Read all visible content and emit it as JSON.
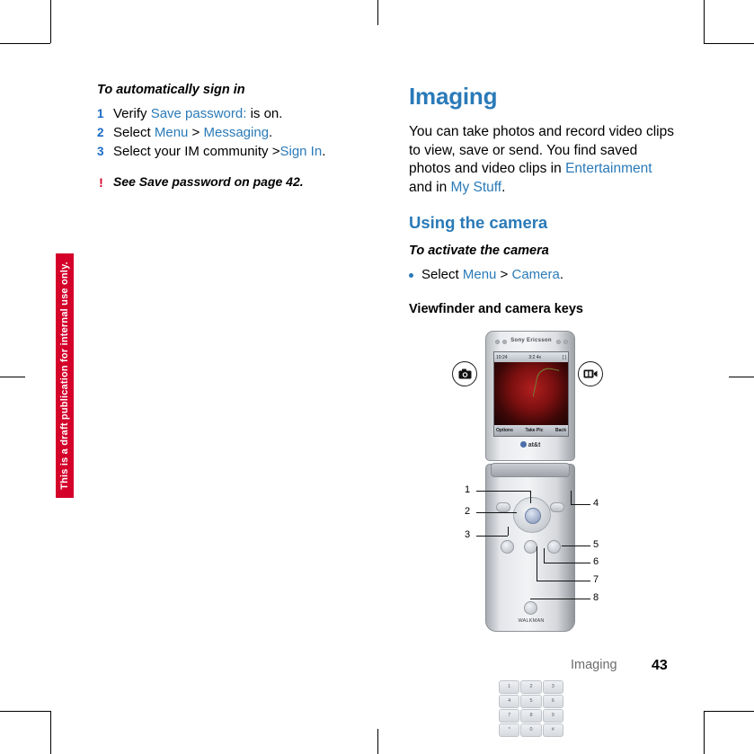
{
  "page": {
    "draft_banner": "This is a draft publication for internal use only.",
    "footer_label": "Imaging",
    "page_number": "43"
  },
  "left_column": {
    "heading": "To automatically sign in",
    "steps": [
      {
        "num": "1",
        "parts": [
          {
            "text": "Verify ",
            "style": "plain"
          },
          {
            "text": "Save password:",
            "style": "link"
          },
          {
            "text": " is on.",
            "style": "plain"
          }
        ]
      },
      {
        "num": "2",
        "parts": [
          {
            "text": "Select ",
            "style": "plain"
          },
          {
            "text": "Menu",
            "style": "link"
          },
          {
            "text": " > ",
            "style": "plain"
          },
          {
            "text": "Messaging",
            "style": "link"
          },
          {
            "text": ".",
            "style": "plain"
          }
        ]
      },
      {
        "num": "3",
        "parts": [
          {
            "text": "Select your IM community >",
            "style": "plain"
          },
          {
            "text": "Sign In",
            "style": "link"
          },
          {
            "text": ".",
            "style": "plain"
          }
        ]
      }
    ],
    "note": {
      "icon": "exclamation-icon",
      "text": "See Save password on page 42."
    }
  },
  "right_column": {
    "title": "Imaging",
    "intro": [
      {
        "text": "You can take photos and record video clips to view, save or send. You find saved photos and video clips in ",
        "style": "plain"
      },
      {
        "text": "Entertainment",
        "style": "link"
      },
      {
        "text": " and in ",
        "style": "plain"
      },
      {
        "text": "My Stuff",
        "style": "link"
      },
      {
        "text": ".",
        "style": "plain"
      }
    ],
    "section_heading": "Using the camera",
    "sub_heading": "To activate the camera",
    "bullet": [
      {
        "text": "Select ",
        "style": "plain"
      },
      {
        "text": "Menu",
        "style": "link"
      },
      {
        "text": " > ",
        "style": "plain"
      },
      {
        "text": "Camera",
        "style": "link"
      },
      {
        "text": ".",
        "style": "plain"
      }
    ],
    "figure_caption": "Viewfinder and camera keys"
  },
  "phone_figure": {
    "callout_left_icon": "camera-icon",
    "callout_right_icon": "video-camera-icon",
    "brand": "Sony Ericsson",
    "carrier": "at&t",
    "screen": {
      "status_left": "10:24",
      "status_mid": "3:2  4x",
      "status_right": "[  ]",
      "soft_left": "Options",
      "soft_mid": "Take Pic",
      "soft_right": "Back"
    },
    "keypad_keys": [
      "1",
      "2",
      "3",
      "4",
      "5",
      "6",
      "7",
      "8",
      "9",
      "*",
      "0",
      "#"
    ],
    "walkman": "WALKMAN",
    "callout_numbers": [
      "1",
      "2",
      "3",
      "4",
      "5",
      "6",
      "7",
      "8"
    ]
  }
}
